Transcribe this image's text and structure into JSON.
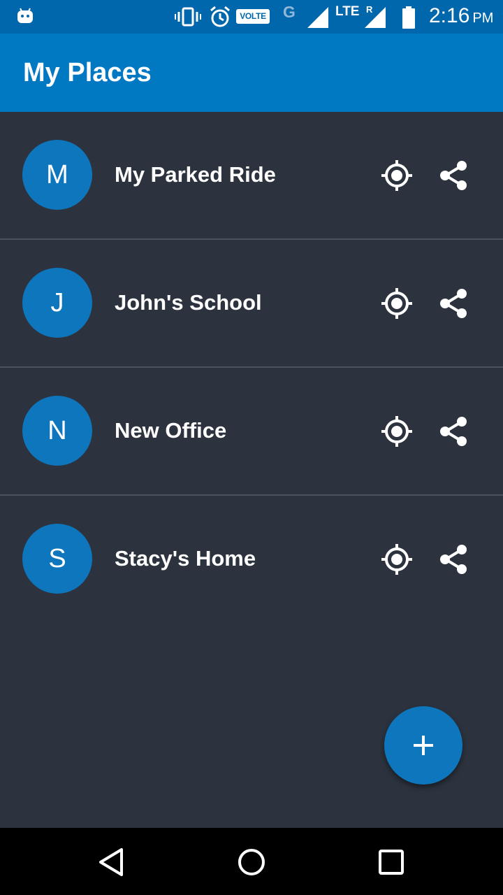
{
  "status_bar": {
    "volte": "VOLTE",
    "network_g": "G",
    "lte": "LTE",
    "roaming": "R",
    "time": "2:16",
    "ampm": "PM",
    "icons": [
      "android-icon",
      "vibrate-icon",
      "alarm-icon",
      "volte-icon",
      "signal-icon",
      "lte-signal-icon",
      "battery-icon"
    ]
  },
  "app_bar": {
    "title": "My Places"
  },
  "places": [
    {
      "initial": "M",
      "name": "My Parked Ride"
    },
    {
      "initial": "J",
      "name": "John's School"
    },
    {
      "initial": "N",
      "name": "New Office"
    },
    {
      "initial": "S",
      "name": "Stacy's Home"
    }
  ],
  "row_icons": [
    "locate-icon",
    "share-icon"
  ],
  "fab": {
    "icon": "plus-icon"
  },
  "nav_bar": {
    "icons": [
      "back-icon",
      "home-icon",
      "recents-icon"
    ]
  },
  "colors": {
    "status_bar": "#0067ad",
    "app_bar": "#0078c2",
    "background": "#2c333e",
    "avatar": "#0e76bd",
    "divider": "#4a525d",
    "text": "#ffffff"
  }
}
